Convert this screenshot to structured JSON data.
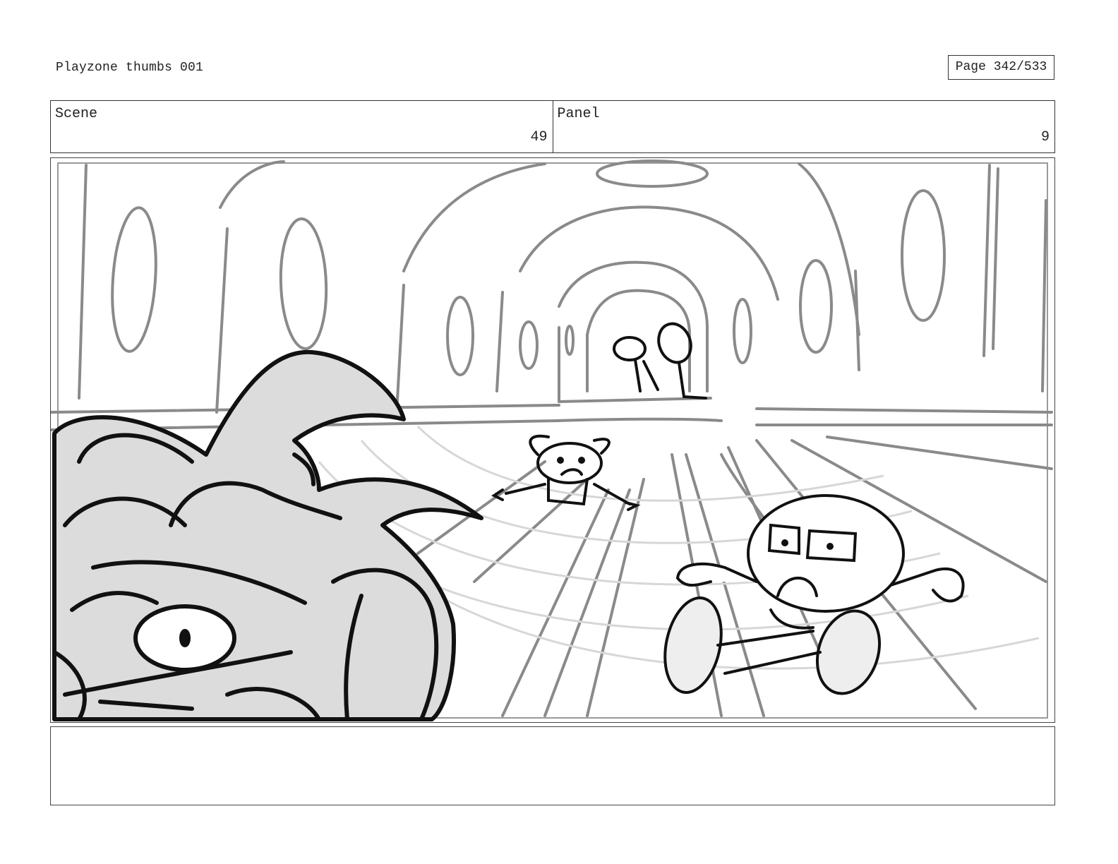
{
  "header": {
    "document_title": "Playzone thumbs 001",
    "page_indicator": "Page 342/533"
  },
  "info": {
    "scene_label": "Scene",
    "scene_value": "49",
    "panel_label": "Panel",
    "panel_value": "9"
  },
  "artwork": {
    "type": "storyboard sketch",
    "palette": {
      "ink": "#111111",
      "background_lines": "#8a8a8a",
      "fill_grey": "#dcdcdc",
      "light_fill": "#eeeeee"
    }
  },
  "notes": {
    "text": ""
  }
}
